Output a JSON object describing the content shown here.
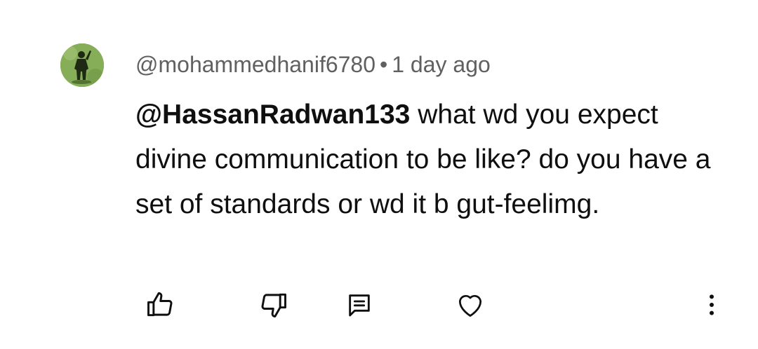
{
  "comment": {
    "author": "@mohammedhanif6780",
    "separator": "•",
    "timestamp": "1 day ago",
    "mention": "@HassanRadwan133",
    "text": " what wd you expect divine communication to be like? do you have a set of standards or wd it b gut-feelimg."
  },
  "actions": {
    "like_icon": "thumbs-up-icon",
    "dislike_icon": "thumbs-down-icon",
    "reply_icon": "reply-icon",
    "heart_icon": "heart-icon",
    "more_icon": "more-vertical-icon"
  },
  "colors": {
    "meta_text": "#606060",
    "body_text": "#0f0f0f",
    "icon": "#0f0f0f"
  }
}
